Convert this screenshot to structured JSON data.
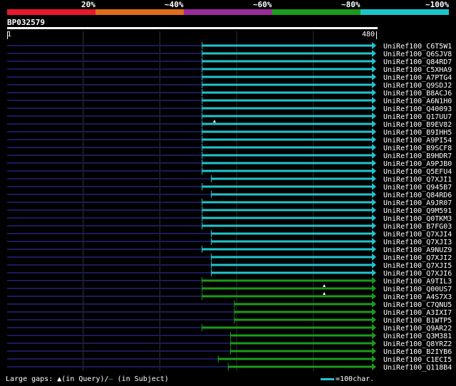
{
  "legend": {
    "labels": [
      "20%",
      "~40%",
      "~60%",
      "~80%",
      "~100%"
    ],
    "colors": [
      "#e8192c",
      "#e06c1c",
      "#9c2c9c",
      "#1c9c1c",
      "#1cc4c8"
    ]
  },
  "query": {
    "id": "BP032579",
    "scale_start": "1",
    "scale_end": "480",
    "length": 480
  },
  "hits": [
    {
      "name": "UniRef100_C6T5W1",
      "color": "cyan",
      "qstart": 255,
      "qend": 480,
      "gap_mark": false
    },
    {
      "name": "UniRef100_Q6SJV8",
      "color": "cyan",
      "qstart": 255,
      "qend": 480,
      "gap_mark": false
    },
    {
      "name": "UniRef100_Q84RD7",
      "color": "cyan",
      "qstart": 255,
      "qend": 480,
      "gap_mark": false
    },
    {
      "name": "UniRef100_C5XHA9",
      "color": "cyan",
      "qstart": 255,
      "qend": 480,
      "gap_mark": false
    },
    {
      "name": "UniRef100_A7PTG4",
      "color": "cyan",
      "qstart": 255,
      "qend": 480,
      "gap_mark": false
    },
    {
      "name": "UniRef100_Q9SDJ2",
      "color": "cyan",
      "qstart": 255,
      "qend": 480,
      "gap_mark": false
    },
    {
      "name": "UniRef100_B8ACJ6",
      "color": "cyan",
      "qstart": 255,
      "qend": 480,
      "gap_mark": false
    },
    {
      "name": "UniRef100_A6N1H0",
      "color": "cyan",
      "qstart": 255,
      "qend": 480,
      "gap_mark": false
    },
    {
      "name": "UniRef100_Q40093",
      "color": "cyan",
      "qstart": 255,
      "qend": 480,
      "gap_mark": false
    },
    {
      "name": "UniRef100_Q17UU7",
      "color": "cyan",
      "qstart": 255,
      "qend": 480,
      "gap_mark": false
    },
    {
      "name": "UniRef100_B9EV82",
      "color": "cyan",
      "qstart": 255,
      "qend": 480,
      "gap_mark": true
    },
    {
      "name": "UniRef100_B9IHH5",
      "color": "cyan",
      "qstart": 255,
      "qend": 480,
      "gap_mark": false
    },
    {
      "name": "UniRef100_A9PI54",
      "color": "cyan",
      "qstart": 255,
      "qend": 480,
      "gap_mark": false
    },
    {
      "name": "UniRef100_B9SCF8",
      "color": "cyan",
      "qstart": 255,
      "qend": 480,
      "gap_mark": false
    },
    {
      "name": "UniRef100_B9HDR7",
      "color": "cyan",
      "qstart": 255,
      "qend": 480,
      "gap_mark": false
    },
    {
      "name": "UniRef100_A9PJB0",
      "color": "cyan",
      "qstart": 255,
      "qend": 480,
      "gap_mark": false
    },
    {
      "name": "UniRef100_Q5EFU4",
      "color": "cyan",
      "qstart": 255,
      "qend": 480,
      "gap_mark": false
    },
    {
      "name": "UniRef100_Q7XJI1",
      "color": "cyan",
      "qstart": 267,
      "qend": 480,
      "gap_mark": false
    },
    {
      "name": "UniRef100_Q945B7",
      "color": "cyan",
      "qstart": 255,
      "qend": 480,
      "gap_mark": false
    },
    {
      "name": "UniRef100_Q84RD6",
      "color": "cyan",
      "qstart": 267,
      "qend": 480,
      "gap_mark": false
    },
    {
      "name": "UniRef100_A9JR07",
      "color": "cyan",
      "qstart": 255,
      "qend": 480,
      "gap_mark": false
    },
    {
      "name": "UniRef100_Q9M591",
      "color": "cyan",
      "qstart": 255,
      "qend": 480,
      "gap_mark": false
    },
    {
      "name": "UniRef100_Q0TKM3",
      "color": "cyan",
      "qstart": 255,
      "qend": 480,
      "gap_mark": false
    },
    {
      "name": "UniRef100_B7FG03",
      "color": "cyan",
      "qstart": 255,
      "qend": 480,
      "gap_mark": false
    },
    {
      "name": "UniRef100_Q7XJI4",
      "color": "cyan",
      "qstart": 267,
      "qend": 480,
      "gap_mark": false
    },
    {
      "name": "UniRef100_Q7XJI3",
      "color": "cyan",
      "qstart": 267,
      "qend": 480,
      "gap_mark": false
    },
    {
      "name": "UniRef100_A9NUZ9",
      "color": "cyan",
      "qstart": 255,
      "qend": 480,
      "gap_mark": false
    },
    {
      "name": "UniRef100_Q7XJI2",
      "color": "cyan",
      "qstart": 267,
      "qend": 480,
      "gap_mark": false
    },
    {
      "name": "UniRef100_Q7XJI5",
      "color": "cyan",
      "qstart": 267,
      "qend": 480,
      "gap_mark": false
    },
    {
      "name": "UniRef100_Q7XJI6",
      "color": "cyan",
      "qstart": 267,
      "qend": 480,
      "gap_mark": false
    },
    {
      "name": "UniRef100_A9TIL3",
      "color": "green",
      "qstart": 255,
      "qend": 480,
      "gap_mark": false
    },
    {
      "name": "UniRef100_Q00US7",
      "color": "green",
      "qstart": 255,
      "qend": 480,
      "gap_mark": true
    },
    {
      "name": "UniRef100_A4S7X3",
      "color": "green",
      "qstart": 255,
      "qend": 480,
      "gap_mark": true
    },
    {
      "name": "UniRef100_C7QNU5",
      "color": "green",
      "qstart": 297,
      "qend": 480,
      "gap_mark": false
    },
    {
      "name": "UniRef100_A3IXI7",
      "color": "green",
      "qstart": 297,
      "qend": 480,
      "gap_mark": false
    },
    {
      "name": "UniRef100_B1WTP5",
      "color": "green",
      "qstart": 297,
      "qend": 480,
      "gap_mark": false
    },
    {
      "name": "UniRef100_Q9AR22",
      "color": "green",
      "qstart": 255,
      "qend": 480,
      "gap_mark": false
    },
    {
      "name": "UniRef100_Q3M381",
      "color": "green",
      "qstart": 292,
      "qend": 480,
      "gap_mark": false
    },
    {
      "name": "UniRef100_Q8YRZ2",
      "color": "green",
      "qstart": 292,
      "qend": 480,
      "gap_mark": false
    },
    {
      "name": "UniRef100_B2IYB6",
      "color": "green",
      "qstart": 292,
      "qend": 480,
      "gap_mark": false
    },
    {
      "name": "UniRef100_C1ECI5",
      "color": "green",
      "qstart": 276,
      "qend": 480,
      "gap_mark": false
    },
    {
      "name": "UniRef100_Q118B4",
      "color": "green",
      "qstart": 289,
      "qend": 480,
      "gap_mark": false
    }
  ],
  "colors": {
    "cyan": "#22c4cc",
    "green": "#1a9c1a",
    "navy": "#1a1a5c",
    "grid": "#333333"
  },
  "footer": {
    "left_prefix": "Large gaps: ",
    "left_query": "(in Query)/",
    "left_mark": "—",
    "left_subject": " (in Subject)",
    "right_label": "=100char."
  }
}
